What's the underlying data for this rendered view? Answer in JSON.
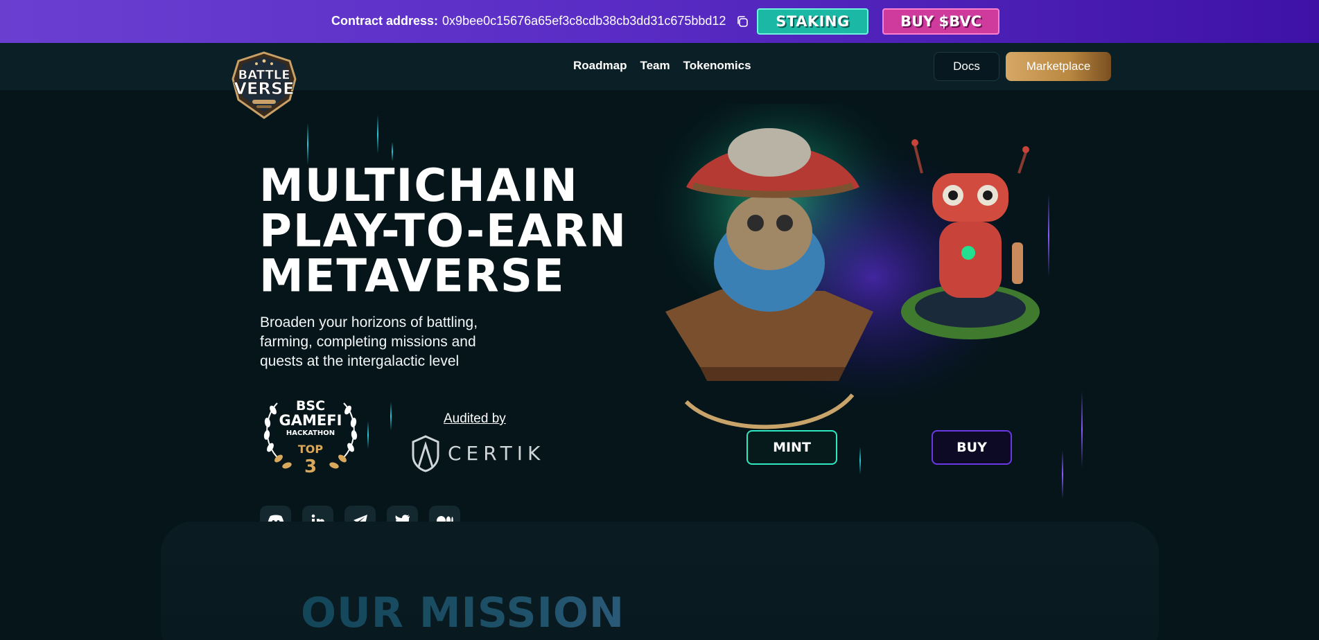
{
  "topbar": {
    "contract_label": "Contract address:",
    "contract_address": "0x9bee0c15676a65ef3c8cdb38cb3dd31c675bbd12",
    "staking_label": "STAKING",
    "buy_label": "BUY $BVC"
  },
  "nav": {
    "logo_text_top": "BATTLE",
    "logo_text_bottom": "VERSE",
    "links": [
      "Roadmap",
      "Team",
      "Tokenomics"
    ],
    "docs_label": "Docs",
    "marketplace_label": "Marketplace"
  },
  "hero": {
    "title_lines": [
      "MULTICHAIN",
      "PLAY-TO-EARN",
      "METAVERSE"
    ],
    "subtitle_lines": [
      "Broaden your horizons of battling,",
      "farming, completing missions and",
      "quests at the intergalactic level"
    ],
    "award": {
      "line1": "BSC",
      "line2": "GAMEFI",
      "line3": "HACKATHON",
      "line4": "TOP",
      "line5": "3"
    },
    "audited_by": "Audited by",
    "certik": "CERTIK",
    "mint_label": "MINT",
    "buy_label": "BUY"
  },
  "socials": [
    "discord-icon",
    "linkedin-icon",
    "telegram-icon",
    "twitter-icon",
    "medium-icon"
  ],
  "mission": {
    "title": "OUR MISSION"
  },
  "colors": {
    "accent_teal": "#2ee8c0",
    "accent_purple": "#6b38e6",
    "staking_bg": "#1bb8a6",
    "buy_bg": "#cf3b9d",
    "marketplace_gold": "#c6964f",
    "page_bg": "#05151a"
  }
}
